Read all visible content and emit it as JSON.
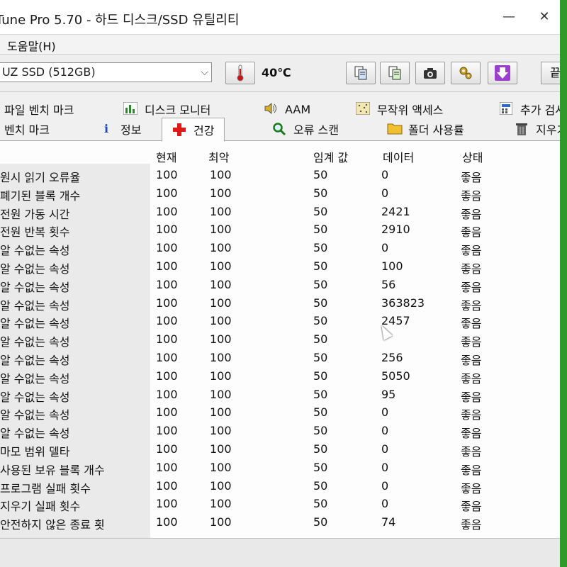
{
  "window": {
    "title": "Tune Pro 5.70 - 하드 디스크/SSD 유틸리티",
    "minimize": "—",
    "close": "✕"
  },
  "menu": {
    "help": "도움말(H)"
  },
  "toolbar": {
    "drive": "UZ SSD (512GB)",
    "temperature": "40℃",
    "exit_label": "끝나"
  },
  "tabs_row1": [
    {
      "label": "파일 벤치 마크"
    },
    {
      "label": "디스크 모니터"
    },
    {
      "label": "AAM"
    },
    {
      "label": "무작위 액세스"
    },
    {
      "label": "추가 검사"
    }
  ],
  "tabs_row2": [
    {
      "label": "벤치 마크"
    },
    {
      "label": "정보"
    },
    {
      "label": "건강"
    },
    {
      "label": "오류 스캔"
    },
    {
      "label": "폴더 사용률"
    },
    {
      "label": "지우기"
    }
  ],
  "table": {
    "headers": {
      "current": "현재",
      "worst": "최악",
      "threshold": "임계 값",
      "data": "데이터",
      "status": "상태"
    },
    "rows": [
      {
        "attr": "원시 읽기 오류율",
        "cur": "100",
        "worst": "100",
        "thr": "50",
        "data": "0",
        "status": "좋음"
      },
      {
        "attr": "폐기된 블록 개수",
        "cur": "100",
        "worst": "100",
        "thr": "50",
        "data": "0",
        "status": "좋음"
      },
      {
        "attr": "전원 가동 시간",
        "cur": "100",
        "worst": "100",
        "thr": "50",
        "data": "2421",
        "status": "좋음"
      },
      {
        "attr": "전원 반복 횟수",
        "cur": "100",
        "worst": "100",
        "thr": "50",
        "data": "2910",
        "status": "좋음"
      },
      {
        "attr": "알 수없는 속성",
        "cur": "100",
        "worst": "100",
        "thr": "50",
        "data": "0",
        "status": "좋음"
      },
      {
        "attr": "알 수없는 속성",
        "cur": "100",
        "worst": "100",
        "thr": "50",
        "data": "100",
        "status": "좋음"
      },
      {
        "attr": "알 수없는 속성",
        "cur": "100",
        "worst": "100",
        "thr": "50",
        "data": "56",
        "status": "좋음"
      },
      {
        "attr": "알 수없는 속성",
        "cur": "100",
        "worst": "100",
        "thr": "50",
        "data": "363823",
        "status": "좋음"
      },
      {
        "attr": "알 수없는 속성",
        "cur": "100",
        "worst": "100",
        "thr": "50",
        "data": "2457",
        "status": "좋음"
      },
      {
        "attr": "알 수없는 속성",
        "cur": "100",
        "worst": "100",
        "thr": "50",
        "data": "",
        "status": "좋음"
      },
      {
        "attr": "알 수없는 속성",
        "cur": "100",
        "worst": "100",
        "thr": "50",
        "data": "256",
        "status": "좋음"
      },
      {
        "attr": "알 수없는 속성",
        "cur": "100",
        "worst": "100",
        "thr": "50",
        "data": "5050",
        "status": "좋음"
      },
      {
        "attr": "알 수없는 속성",
        "cur": "100",
        "worst": "100",
        "thr": "50",
        "data": "95",
        "status": "좋음"
      },
      {
        "attr": "알 수없는 속성",
        "cur": "100",
        "worst": "100",
        "thr": "50",
        "data": "0",
        "status": "좋음"
      },
      {
        "attr": "알 수없는 속성",
        "cur": "100",
        "worst": "100",
        "thr": "50",
        "data": "0",
        "status": "좋음"
      },
      {
        "attr": "마모 범위 델타",
        "cur": "100",
        "worst": "100",
        "thr": "50",
        "data": "0",
        "status": "좋음"
      },
      {
        "attr": "사용된 보유 블록 개수",
        "cur": "100",
        "worst": "100",
        "thr": "50",
        "data": "0",
        "status": "좋음"
      },
      {
        "attr": "프로그램 실패 횟수",
        "cur": "100",
        "worst": "100",
        "thr": "50",
        "data": "0",
        "status": "좋음"
      },
      {
        "attr": "지우기 실패 횟수",
        "cur": "100",
        "worst": "100",
        "thr": "50",
        "data": "0",
        "status": "좋음"
      },
      {
        "attr": "안전하지 않은 종료 횟",
        "cur": "100",
        "worst": "100",
        "thr": "50",
        "data": "74",
        "status": "좋음"
      }
    ]
  }
}
